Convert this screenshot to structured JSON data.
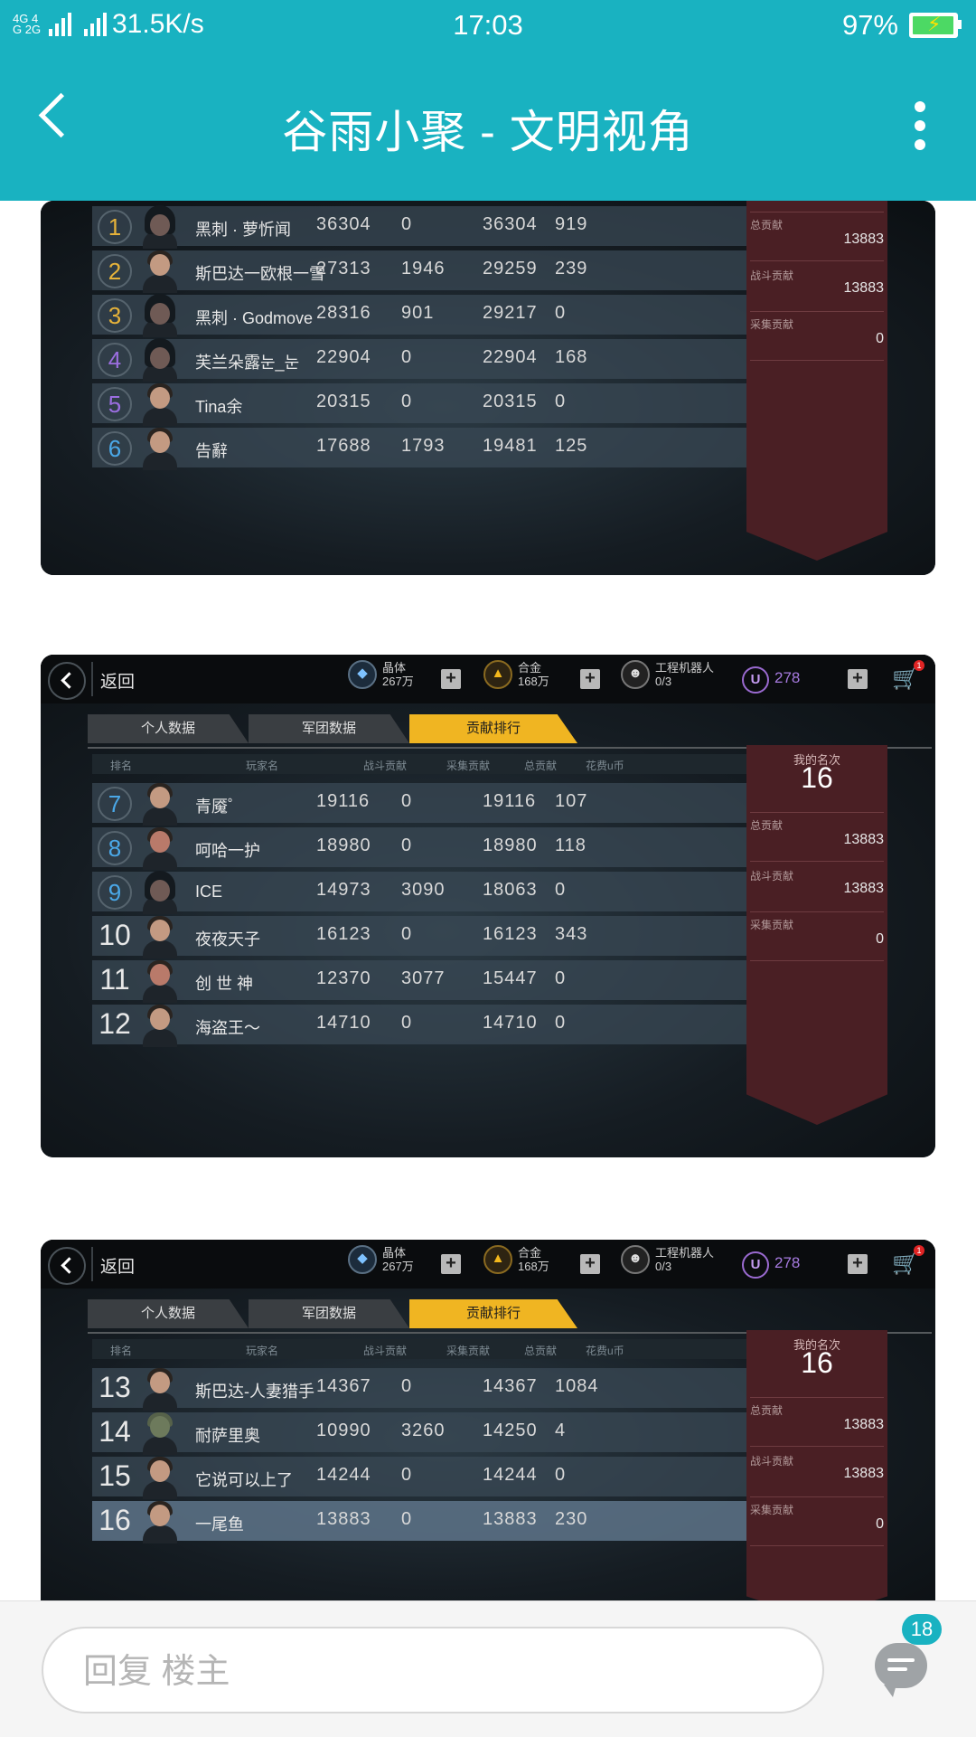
{
  "status_bar": {
    "network": "4G 4G 2G",
    "speed": "31.5K/s",
    "time": "17:03",
    "battery": "97%"
  },
  "header": {
    "title": "谷雨小聚 - 文明视角"
  },
  "game": {
    "back_label": "返回",
    "crystal": {
      "label": "晶体",
      "value": "267万"
    },
    "alloy": {
      "label": "合金",
      "value": "168万"
    },
    "robot": {
      "label": "工程机器人",
      "value": "0/3"
    },
    "u_coin": "278",
    "cart_badge": "1",
    "tabs": [
      "个人数据",
      "军团数据",
      "贡献排行"
    ],
    "columns": [
      "排名",
      "玩家名",
      "战斗贡献",
      "采集贡献",
      "总贡献",
      "花费u币"
    ],
    "my_rank": {
      "title": "我的名次",
      "rank": "16",
      "total_label": "总贡献",
      "total": "13883",
      "battle_label": "战斗贡献",
      "battle": "13883",
      "gather_label": "采集贡献",
      "gather": "0"
    }
  },
  "shot1_rows": [
    {
      "rank": "1",
      "name": "黑刺 · 萝忻闻",
      "battle": "36304",
      "gather": "0",
      "total": "36304",
      "u": "919"
    },
    {
      "rank": "2",
      "name": "斯巴达一欧根一雪",
      "battle": "27313",
      "gather": "1946",
      "total": "29259",
      "u": "239"
    },
    {
      "rank": "3",
      "name": "黑刺 · Godmove",
      "battle": "28316",
      "gather": "901",
      "total": "29217",
      "u": "0"
    },
    {
      "rank": "4",
      "name": "芙兰朵露눈_눈",
      "battle": "22904",
      "gather": "0",
      "total": "22904",
      "u": "168"
    },
    {
      "rank": "5",
      "name": "Tina余",
      "battle": "20315",
      "gather": "0",
      "total": "20315",
      "u": "0"
    },
    {
      "rank": "6",
      "name": "告辭",
      "battle": "17688",
      "gather": "1793",
      "total": "19481",
      "u": "125"
    }
  ],
  "shot2_rows": [
    {
      "rank": "7",
      "name": "青魇゜",
      "battle": "19116",
      "gather": "0",
      "total": "19116",
      "u": "107"
    },
    {
      "rank": "8",
      "name": "呵哈一护",
      "battle": "18980",
      "gather": "0",
      "total": "18980",
      "u": "118"
    },
    {
      "rank": "9",
      "name": "ICE",
      "battle": "14973",
      "gather": "3090",
      "total": "18063",
      "u": "0"
    },
    {
      "rank": "10",
      "name": "夜夜天子",
      "battle": "16123",
      "gather": "0",
      "total": "16123",
      "u": "343"
    },
    {
      "rank": "11",
      "name": "创 世 神",
      "battle": "12370",
      "gather": "3077",
      "total": "15447",
      "u": "0"
    },
    {
      "rank": "12",
      "name": "海盗王～",
      "battle": "14710",
      "gather": "0",
      "total": "14710",
      "u": "0"
    }
  ],
  "shot3_rows": [
    {
      "rank": "13",
      "name": "斯巴达-人妻猎手",
      "battle": "14367",
      "gather": "0",
      "total": "14367",
      "u": "1084"
    },
    {
      "rank": "14",
      "name": "耐萨里奥",
      "battle": "10990",
      "gather": "3260",
      "total": "14250",
      "u": "4"
    },
    {
      "rank": "15",
      "name": "它说可以上了",
      "battle": "14244",
      "gather": "0",
      "total": "14244",
      "u": "0"
    },
    {
      "rank": "16",
      "name": "一尾鱼",
      "battle": "13883",
      "gather": "0",
      "total": "13883",
      "u": "230"
    }
  ],
  "reply": {
    "placeholder": "回复  楼主",
    "comment_count": "18"
  }
}
